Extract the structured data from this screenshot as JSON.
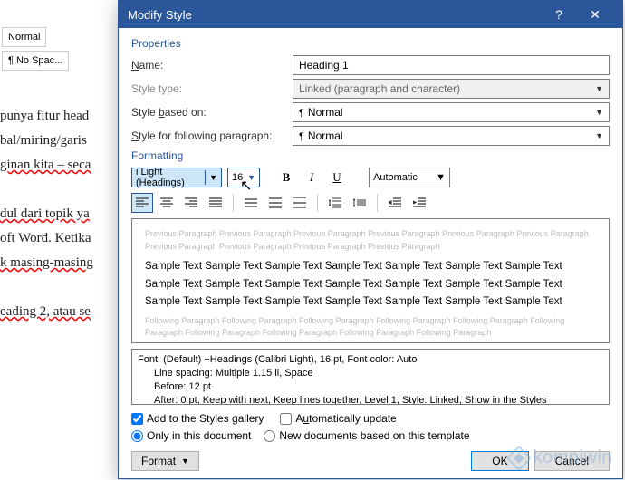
{
  "dialog": {
    "title": "Modify Style",
    "properties_label": "Properties",
    "name_label": "Name:",
    "name_value": "Heading 1",
    "style_type_label": "Style type:",
    "style_type_value": "Linked (paragraph and character)",
    "based_on_label": "Style based on:",
    "based_on_value": "Normal",
    "following_label": "Style for following paragraph:",
    "following_value": "Normal",
    "formatting_label": "Formatting",
    "font_value": "i Light (Headings)",
    "size_value": "16",
    "bold": "B",
    "italic": "I",
    "underline": "U",
    "color_value": "Automatic",
    "preview": {
      "prev": "Previous Paragraph Previous Paragraph Previous Paragraph Previous Paragraph Previous Paragraph Previous Paragraph Previous Paragraph Previous Paragraph Previous Paragraph Previous Paragraph",
      "sample": "Sample Text Sample Text Sample Text Sample Text Sample Text Sample Text Sample Text Sample Text Sample Text Sample Text Sample Text Sample Text Sample Text Sample Text Sample Text Sample Text Sample Text Sample Text Sample Text Sample Text Sample Text",
      "follow": "Following Paragraph Following Paragraph Following Paragraph Following Paragraph Following Paragraph Following Paragraph Following Paragraph Following Paragraph Following Paragraph Following Paragraph"
    },
    "desc_line1": "Font: (Default) +Headings (Calibri Light), 16 pt, Font color: Auto",
    "desc_line2": "Line spacing:  Multiple 1.15 li, Space",
    "desc_line3": "Before:  12 pt",
    "desc_line4": "After:  0 pt, Keep with next, Keep lines together, Level 1, Style: Linked, Show in the Styles",
    "add_gallery": "Add to the Styles gallery",
    "auto_update": "Automatically update",
    "only_doc": "Only in this document",
    "new_template": "New documents based on this template",
    "format_btn": "Format",
    "ok": "OK",
    "cancel": "Cancel"
  },
  "bg": {
    "style1": "Normal",
    "style2": "¶ No Spac...",
    "lines": [
      "punya fitur head",
      "bal/miring/garis",
      "ginan kita – seca",
      "dul dari topik ya",
      "oft Word. Ketika",
      "k masing-masing",
      "eading 2, atau se"
    ]
  },
  "watermark": "kompiwin"
}
